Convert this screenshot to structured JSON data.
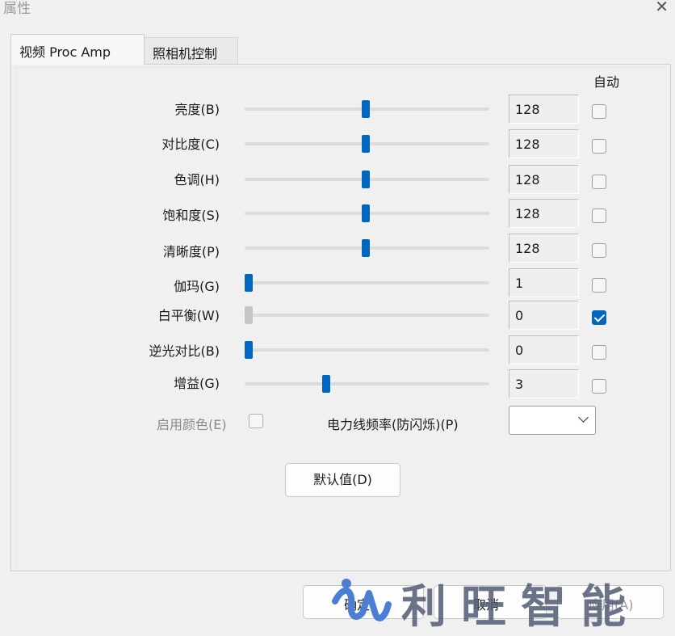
{
  "window": {
    "title": "属性"
  },
  "tabs": [
    {
      "label": "视频 Proc Amp",
      "active": true
    },
    {
      "label": "照相机控制",
      "active": false
    }
  ],
  "auto_header": "自动",
  "slider_range": [
    0,
    255
  ],
  "rows": [
    {
      "label": "亮度(B)",
      "value": "128",
      "pos": 0.5,
      "auto": false,
      "disabled": false
    },
    {
      "label": "对比度(C)",
      "value": "128",
      "pos": 0.5,
      "auto": false,
      "disabled": false
    },
    {
      "label": "色调(H)",
      "value": "128",
      "pos": 0.5,
      "auto": false,
      "disabled": false
    },
    {
      "label": "饱和度(S)",
      "value": "128",
      "pos": 0.5,
      "auto": false,
      "disabled": false
    },
    {
      "label": "清晰度(P)",
      "value": "128",
      "pos": 0.5,
      "auto": false,
      "disabled": false
    },
    {
      "label": "伽玛(G)",
      "value": "1",
      "pos": 0.0,
      "auto": false,
      "disabled": false
    },
    {
      "label": "白平衡(W)",
      "value": "0",
      "pos": 0.0,
      "auto": true,
      "disabled": true
    },
    {
      "label": "逆光对比(B)",
      "value": "0",
      "pos": 0.0,
      "auto": false,
      "disabled": false
    },
    {
      "label": "增益(G)",
      "value": "3",
      "pos": 0.33,
      "auto": false,
      "disabled": false
    }
  ],
  "enable_color": {
    "label": "启用颜色(E)",
    "checked": false
  },
  "power_freq": {
    "label": "电力线频率(防闪烁)(P)",
    "value": ""
  },
  "default_button": "默认值(D)",
  "buttons": {
    "ok": "确定",
    "cancel": "取消",
    "apply": "应用(A)"
  },
  "watermark": {
    "text": "利旺智能",
    "color": "#4a7fd4"
  },
  "colors": {
    "accent": "#0067c0",
    "background": "#f0f0f0"
  }
}
